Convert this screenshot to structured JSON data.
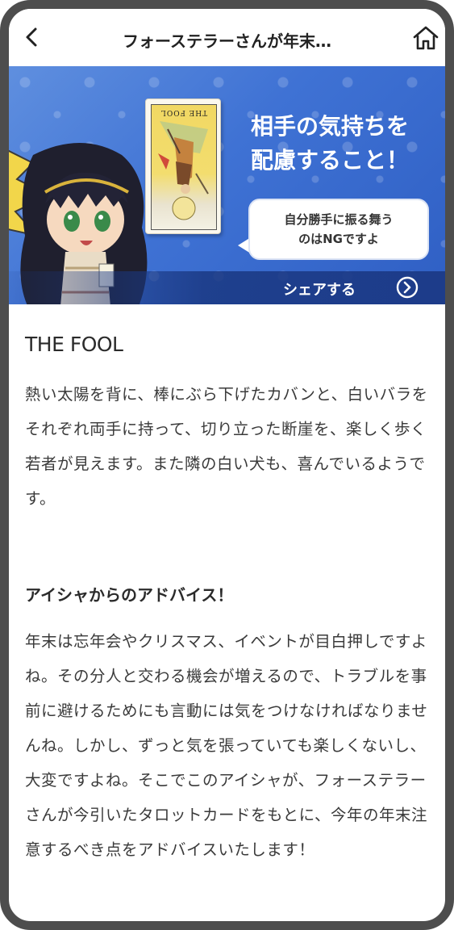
{
  "header": {
    "title": "フォーステラーさんが年末…",
    "back_icon": "chevron-left-icon",
    "home_icon": "home-icon"
  },
  "banner": {
    "card_label": "THE FOOL",
    "heading_line1": "相手の気持ちを",
    "heading_line2": "配慮すること！",
    "bubble_line1": "自分勝手に振る舞う",
    "bubble_line2": "のはNGですよ",
    "share_label": "シェアする",
    "share_icon": "chevron-right-circle-icon",
    "colors": {
      "banner_blue": "#3f72d4",
      "share_bar": "#1d3c8a"
    }
  },
  "content": {
    "card_name": "THE FOOL",
    "description": "熱い太陽を背に、棒にぶら下げたカバンと、白いバラをそれぞれ両手に持って、切り立った断崖を、楽しく歩く若者が見えます。また隣の白い犬も、喜んでいるようです。",
    "advice_heading": "アイシャからのアドバイス！",
    "advice_text": "年末は忘年会やクリスマス、イベントが目白押しですよね。その分人と交わる機会が増えるので、トラブルを事前に避けるためにも言動には気をつけなければなりませんね。しかし、ずっと気を張っていても楽しくないし、大変ですよね。そこでこのアイシャが、フォーステラーさんが今引いたタロットカードをもとに、今年の年末注意するべき点をアドバイスいたします！"
  }
}
